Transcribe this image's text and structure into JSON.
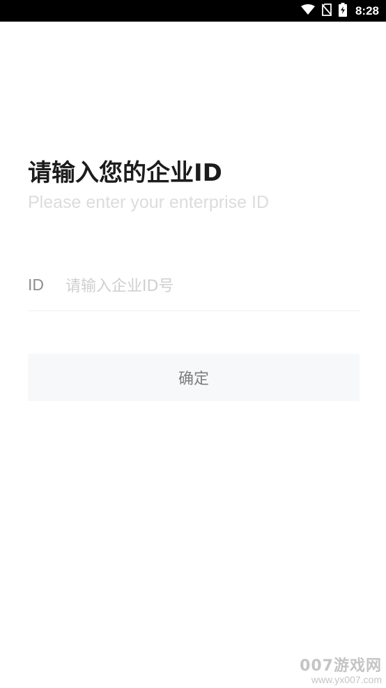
{
  "status_bar": {
    "time": "8:28",
    "icons": [
      "wifi-icon",
      "no-sim-icon",
      "battery-charging-icon"
    ]
  },
  "header": {
    "title": "请输入您的企业ID",
    "subtitle": "Please enter your enterprise ID"
  },
  "form": {
    "id_label": "ID",
    "id_placeholder": "请输入企业ID号",
    "id_value": "",
    "confirm_label": "确定"
  },
  "watermark": {
    "main": "007游戏网",
    "url": "www.yx007.com"
  },
  "colors": {
    "title": "#1c1c1c",
    "subtitle": "#dcdcdc",
    "label": "#8e8e8e",
    "placeholder": "#cfcfcf",
    "button_bg": "#f7f8fa",
    "button_text": "#7d7d7d",
    "status_bar": "#000000"
  }
}
